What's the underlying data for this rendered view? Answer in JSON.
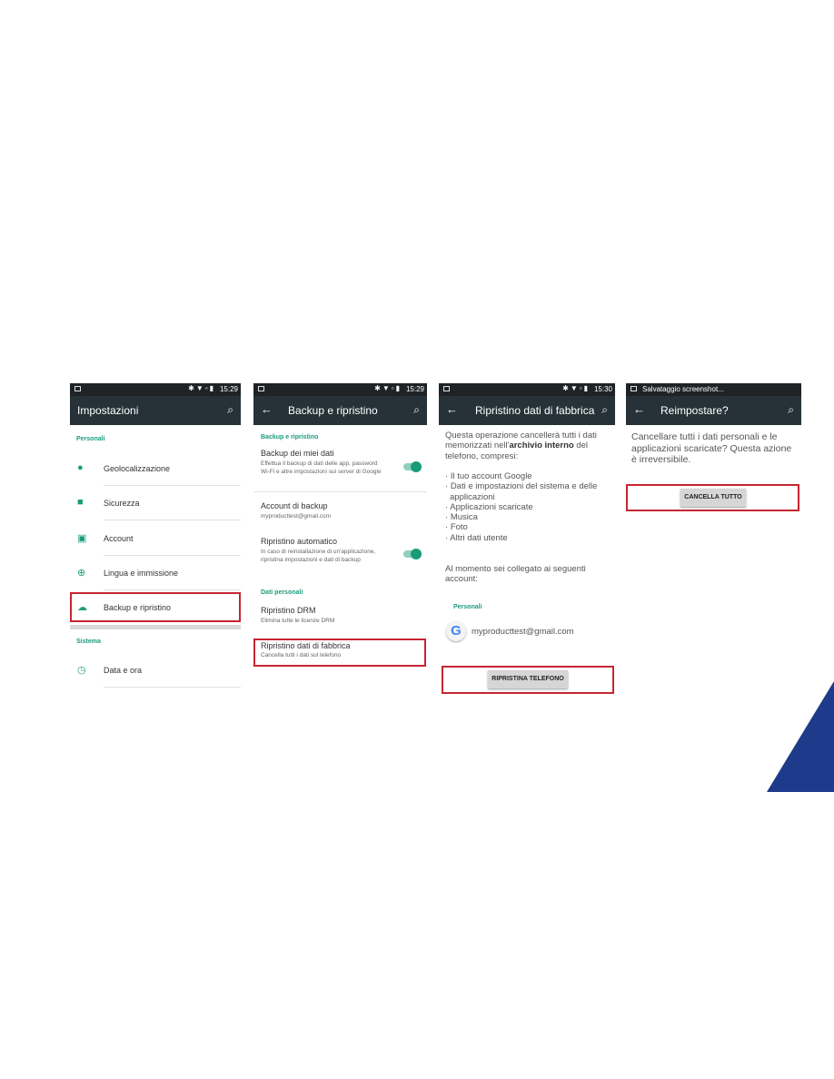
{
  "screens": [
    {
      "status": {
        "time": "15:29"
      },
      "title": "Impostazioni",
      "sections": [
        {
          "header": "Personali",
          "items": [
            "Geolocalizzazione",
            "Sicurezza",
            "Account",
            "Lingua e immissione",
            "Backup e ripristino"
          ]
        },
        {
          "header": "Sistema",
          "items": [
            "Data e ora"
          ]
        }
      ],
      "highlighted": "Backup e ripristino"
    },
    {
      "status": {
        "time": "15:29"
      },
      "title": "Backup e ripristino",
      "sections": [
        {
          "header": "Backup e ripristino",
          "items": [
            {
              "title": "Backup dei miei dati",
              "subtitle": "Effettua il backup di dati delle app, password Wi-Fi e altre impostazioni sui server di Google",
              "toggle": true
            },
            {
              "title": "Account di backup",
              "subtitle": "myproducttest@gmail.com"
            },
            {
              "title": "Ripristino automatico",
              "subtitle": "In caso di reinstallazione di un'applicazione, ripristina impostazioni e dati di backup",
              "toggle": true
            }
          ]
        },
        {
          "header": "Dati personali",
          "items": [
            {
              "title": "Ripristino DRM",
              "subtitle": "Elimina tutte le licenze DRM"
            },
            {
              "title": "Ripristino dati di fabbrica",
              "subtitle": "Cancella tutti i dati sul telefono"
            }
          ]
        }
      ]
    },
    {
      "status": {
        "time": "15:30"
      },
      "title": "Ripristino dati di fabbrica",
      "intro_1": "Questa operazione cancellerà tutti i dati memorizzati nell'",
      "intro_bold": "archivio interno",
      "intro_2": " del telefono, compresi:",
      "bullets": [
        "Il tuo account Google",
        "Dati e impostazioni del sistema e delle applicazioni",
        "Applicazioni scaricate",
        "Musica",
        "Foto",
        "Altri dati utente"
      ],
      "accounts_text": "Al momento sei collegato ai seguenti account:",
      "accounts_header": "Personali",
      "account": "myproducttest@gmail.com",
      "button": "RIPRISTINA TELEFONO"
    },
    {
      "status": {
        "notification": "Salvataggio screenshot..."
      },
      "title": "Reimpostare?",
      "text": "Cancellare tutti i dati personali e le applicazioni scaricate? Questa azione è irreversibile.",
      "button": "CANCELLA TUTTO"
    }
  ],
  "colors": {
    "accent": "#1a9c7b",
    "toolbar": "#263238",
    "highlight": "#c62631",
    "corner": "#1e3a8a"
  }
}
